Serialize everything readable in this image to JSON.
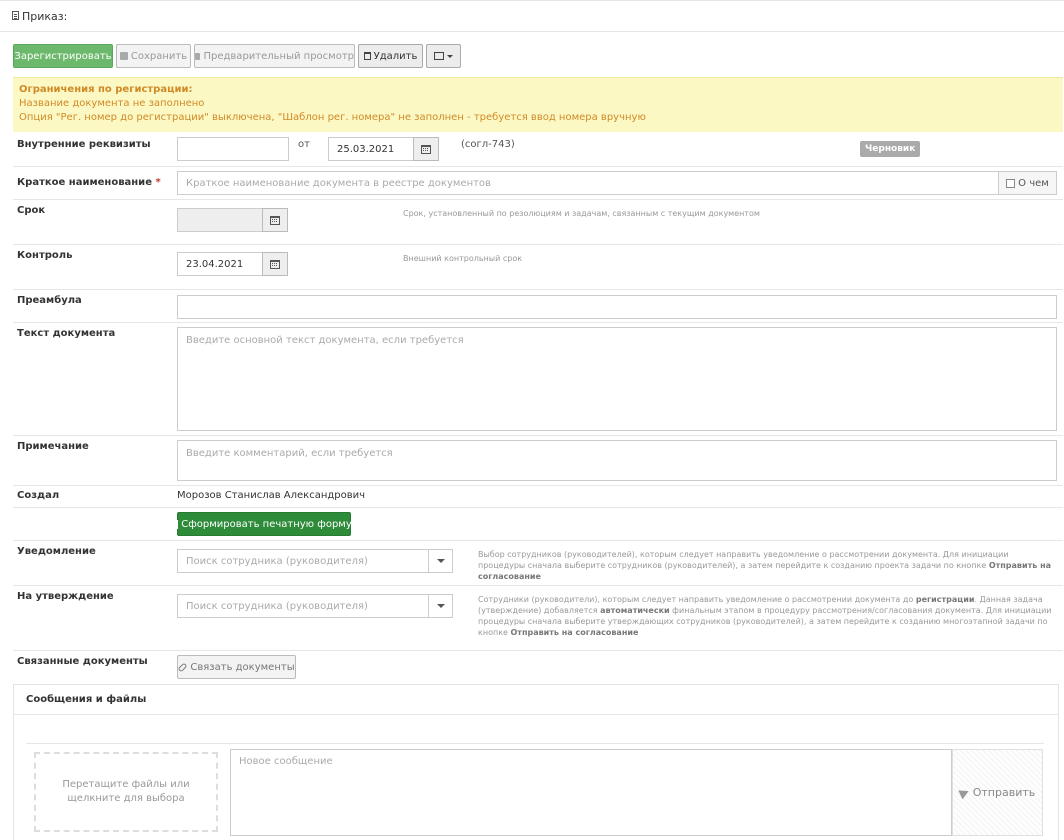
{
  "header": {
    "title": "Приказ:"
  },
  "toolbar": {
    "register": "Зарегистрировать",
    "save": "Сохранить",
    "preview": "Предварительный просмотр",
    "delete": "Удалить"
  },
  "warning": {
    "title": "Ограничения по регистрации:",
    "line1": "Название документа не заполнено",
    "line2": "Опция \"Рег. номер до регистрации\" выключена, \"Шаблон рег. номера\" не заполнен - требуется ввод номера вручную"
  },
  "form": {
    "internal": {
      "label": "Внутренние реквизиты",
      "from": "от",
      "date": "25.03.2021",
      "code": "(согл-743)",
      "status": "Черновик"
    },
    "short_name": {
      "label": "Краткое наименование",
      "required": "*",
      "placeholder": "Краткое наименование документа в реестре документов",
      "about_label": "О чем"
    },
    "deadline": {
      "label": "Срок",
      "hint": "Срок, установленный по резолюциям и задачам, связанным с текущим документом"
    },
    "control": {
      "label": "Контроль",
      "date": "23.04.2021",
      "hint": "Внешний контрольный срок"
    },
    "preamble": {
      "label": "Преамбула"
    },
    "body": {
      "label": "Текст документа",
      "placeholder": "Введите основной текст документа, если требуется"
    },
    "note": {
      "label": "Примечание",
      "placeholder": "Введите комментарий, если требуется"
    },
    "created": {
      "label": "Создал",
      "value": "Морозов Станислав Александрович",
      "print_button": "Сформировать печатную форму"
    },
    "notify": {
      "label": "Уведомление",
      "placeholder": "Поиск сотрудника (руководителя)",
      "hint1": "Выбор сотрудников (руководителей), которым следует направить уведомление о рассмотрении документа. Для инициации процедуры сначала выберите сотрудников (руководителей), а затем перейдите к созданию проекта задачи по кнопке",
      "hint_bold": "Отправить на согласование"
    },
    "approve": {
      "label": "На утверждение",
      "placeholder": "Поиск сотрудника (руководителя)",
      "hint_a": "Сотрудники (руководители), которым следует направить уведомление о рассмотрении документа до",
      "hint_b": "регистрации",
      "hint_c": ". Данная задача (утверждение) добавляется",
      "hint_d": "автоматически",
      "hint_e": "финальным этапом в процедуру рассмотрения/согласования документа. Для инициации процедуры сначала выберите утверждающих сотрудников (руководителей), а затем перейдите к созданию многоэтапной задачи по кнопке",
      "hint_f": "Отправить на согласование"
    },
    "linked": {
      "label": "Связанные документы",
      "button": "Связать документы"
    }
  },
  "messages": {
    "title": "Сообщения и файлы",
    "dropzone": "Перетащите файлы или щелкните для выбора",
    "placeholder": "Новое сообщение",
    "send": "Отправить"
  }
}
